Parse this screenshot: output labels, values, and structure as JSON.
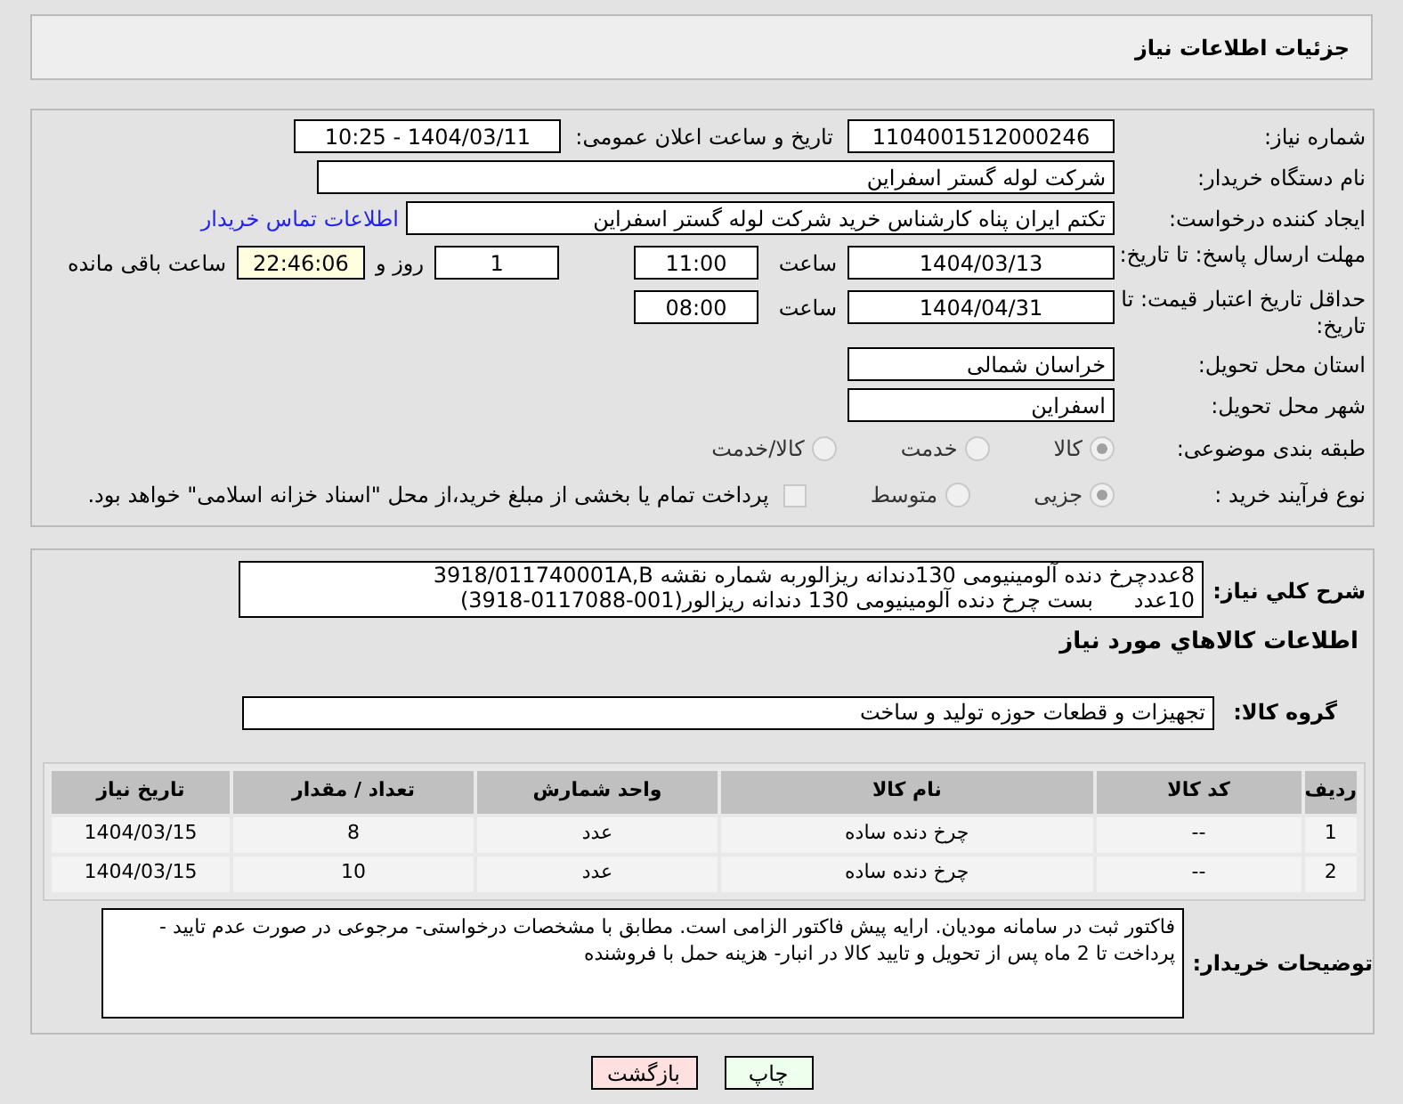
{
  "header": {
    "title": "جزئیات اطلاعات نیاز"
  },
  "need_number": {
    "label": "شماره نیاز:",
    "value": "1104001512000246"
  },
  "announce": {
    "label": "تاریخ و ساعت اعلان عمومی:",
    "value": "1404/03/11 - 10:25"
  },
  "buyer_org": {
    "label": "نام دستگاه خریدار:",
    "value": "شرکت لوله گستر اسفراین"
  },
  "requester": {
    "label": "ایجاد کننده درخواست:",
    "value": "تکتم ایران پناه کارشناس خرید شرکت لوله گستر اسفراین",
    "link": "اطلاعات تماس خریدار"
  },
  "deadline": {
    "label": "مهلت ارسال پاسخ: تا تاریخ:",
    "date": "1404/03/13",
    "time_label": "ساعت",
    "time": "11:00",
    "days": "1",
    "days_label": "روز و",
    "remaining": "22:46:06",
    "remaining_label": "ساعت باقی مانده"
  },
  "validity": {
    "label": "حداقل تاریخ اعتبار قیمت: تا تاریخ:",
    "date": "1404/04/31",
    "time_label": "ساعت",
    "time": "08:00"
  },
  "province": {
    "label": "استان محل تحویل:",
    "value": "خراسان شمالی"
  },
  "city": {
    "label": "شهر محل تحویل:",
    "value": "اسفراین"
  },
  "category": {
    "label": "طبقه بندی موضوعی:",
    "disabled": true,
    "options": [
      {
        "label": "کالا",
        "selected": true
      },
      {
        "label": "خدمت",
        "selected": false
      },
      {
        "label": "کالا/خدمت",
        "selected": false
      }
    ]
  },
  "purchase_type": {
    "label": "نوع فرآیند خرید :",
    "disabled": true,
    "options": [
      {
        "label": "جزیی",
        "selected": true
      },
      {
        "label": "متوسط",
        "selected": false
      }
    ],
    "treasury": {
      "label": "پرداخت تمام یا بخشی از مبلغ خرید،از محل \"اسناد خزانه اسلامی\" خواهد بود.",
      "checked": false
    }
  },
  "summary": {
    "label": "شرح کلي نياز:",
    "lines": [
      "8عددچرخ دنده آلومینیومی 130دندانه ریزالوربه شماره نقشه 3918/011740001A,B",
      "10عدد      بست چرخ دنده آلومینیومی 130 دندانه ریزالور(001-0117088-3918)"
    ]
  },
  "goods_title": "اطلاعات کالاهاي مورد نياز",
  "goods_group": {
    "label": "گروه کالا:",
    "value": "تجهیزات و قطعات حوزه تولید و ساخت"
  },
  "table": {
    "columns": [
      "ردیف",
      "کد کالا",
      "نام کالا",
      "واحد شمارش",
      "تعداد / مقدار",
      "تاریخ نیاز"
    ],
    "rows": [
      [
        "1",
        "--",
        "چرخ دنده ساده",
        "عدد",
        "8",
        "1404/03/15"
      ],
      [
        "2",
        "--",
        "چرخ دنده ساده",
        "عدد",
        "10",
        "1404/03/15"
      ]
    ]
  },
  "buyer_notes": {
    "label": "توضیحات خریدار:",
    "value": "فاکتور ثبت در سامانه مودیان. ارایه پیش فاکتور الزامی است. مطابق با مشخصات درخواستی- مرجوعی در صورت عدم تایید - پرداخت تا 2 ماه پس از تحویل و تایید کالا در انبار- هزینه حمل با فروشنده"
  },
  "buttons": [
    {
      "kind": "print",
      "label": "چاپ"
    },
    {
      "kind": "back",
      "label": "بازگشت"
    }
  ]
}
